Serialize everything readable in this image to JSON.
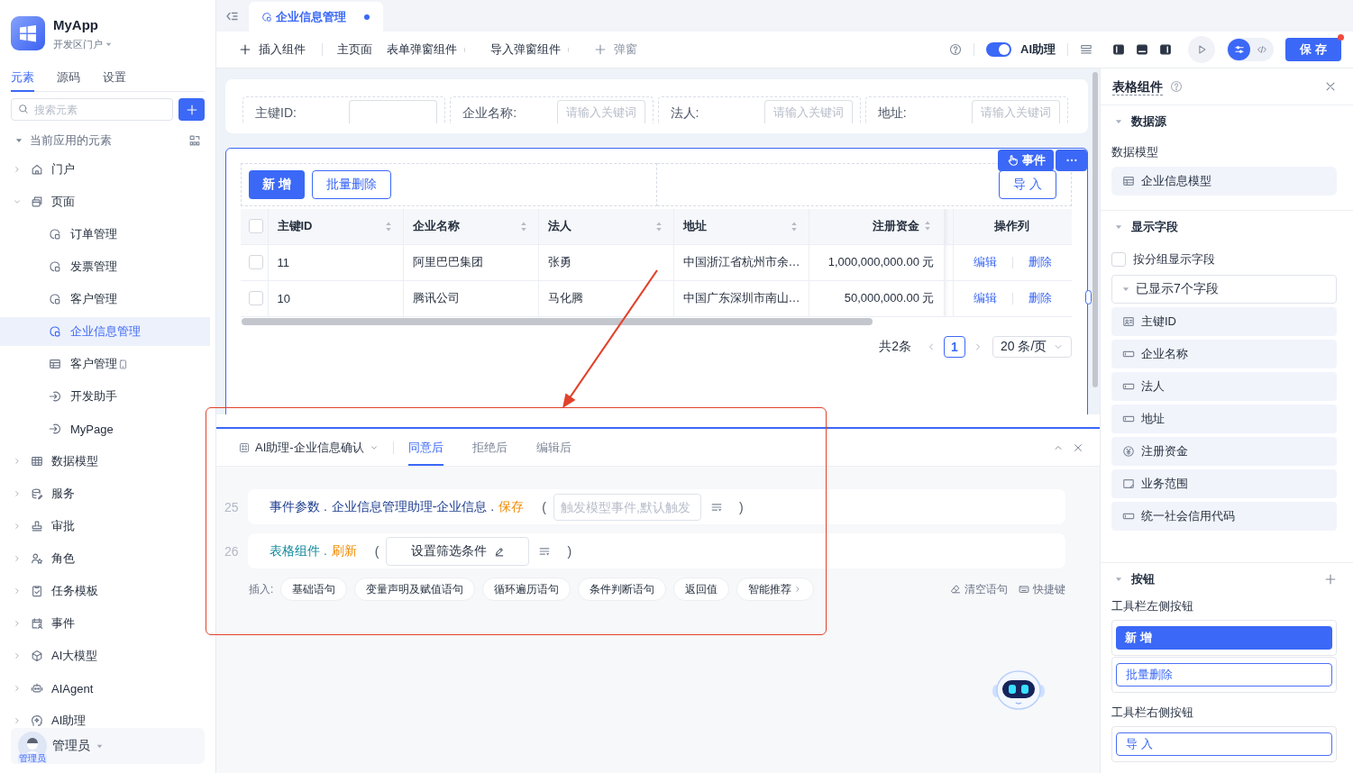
{
  "sidebar": {
    "app_name": "MyApp",
    "portal": "开发区门户",
    "tabs": [
      {
        "label": "元素",
        "selected": true
      },
      {
        "label": "源码",
        "selected": false
      },
      {
        "label": "设置",
        "selected": false
      }
    ],
    "search": {
      "placeholder": "搜索元素"
    },
    "tree": {
      "title": "当前应用的元素",
      "expanded": true,
      "items": [
        {
          "label": "门户",
          "kind": "portal",
          "expanded": false,
          "selected": false
        },
        {
          "label": "页面",
          "kind": "pages",
          "expanded": true,
          "selected": false,
          "children": [
            {
              "label": "订单管理",
              "kind": "page",
              "selected": false
            },
            {
              "label": "发票管理",
              "kind": "page",
              "selected": false
            },
            {
              "label": "客户管理",
              "kind": "page",
              "selected": false
            },
            {
              "label": "企业信息管理",
              "kind": "page",
              "selected": true
            },
            {
              "label": "客户管理",
              "kind": "mobile-page",
              "selected": false
            },
            {
              "label": "开发助手",
              "kind": "link",
              "selected": false
            },
            {
              "label": "MyPage",
              "kind": "link",
              "selected": false
            }
          ]
        },
        {
          "label": "数据模型",
          "kind": "data-model",
          "expanded": false,
          "selected": false
        },
        {
          "label": "服务",
          "kind": "service",
          "expanded": false,
          "selected": false
        },
        {
          "label": "审批",
          "kind": "approval",
          "expanded": false,
          "selected": false
        },
        {
          "label": "角色",
          "kind": "role",
          "expanded": false,
          "selected": false
        },
        {
          "label": "任务模板",
          "kind": "task",
          "expanded": false,
          "selected": false
        },
        {
          "label": "事件",
          "kind": "event",
          "expanded": false,
          "selected": false
        },
        {
          "label": "AI大模型",
          "kind": "model",
          "expanded": false,
          "selected": false
        },
        {
          "label": "AIAgent",
          "kind": "agent",
          "expanded": false,
          "selected": false
        },
        {
          "label": "AI助理",
          "kind": "assistant",
          "expanded": false,
          "selected": false
        }
      ]
    },
    "user": {
      "name": "管理员",
      "badge": "管理员"
    }
  },
  "editor_tabs": [
    {
      "label": "企业信息管理",
      "selected": true,
      "unsaved": true
    }
  ],
  "toolbar": {
    "left": [
      {
        "label": "插入组件",
        "kind": "add"
      },
      {
        "label": "主页面",
        "kind": "plain"
      },
      {
        "label": "表单弹窗组件",
        "kind": "menu"
      },
      {
        "label": "导入弹窗组件",
        "kind": "menu"
      },
      {
        "label": "弹窗",
        "kind": "add-muted"
      }
    ],
    "ai_toggle": {
      "label": "AI助理",
      "on": true
    },
    "view_modes": [
      {
        "kind": "design",
        "selected": true
      },
      {
        "kind": "code",
        "selected": false
      }
    ],
    "save": {
      "label": "保 存",
      "badge_dot": true
    }
  },
  "filter_form": {
    "fields": [
      {
        "label": "主键ID:"
      },
      {
        "label": "企业名称:",
        "placeholder": "请输入关键词"
      },
      {
        "label": "法人:",
        "placeholder": "请输入关键词"
      },
      {
        "label": "地址:",
        "placeholder": "请输入关键词"
      }
    ]
  },
  "table_card": {
    "event_button": "事件",
    "toolbar_left": [
      {
        "label": "新 增",
        "kind": "primary"
      },
      {
        "label": "批量删除",
        "kind": "outline"
      }
    ],
    "toolbar_right": [
      {
        "label": "导 入",
        "kind": "outline"
      }
    ],
    "table": {
      "all_selected": false,
      "columns": [
        {
          "label": "主键ID",
          "kind": "text",
          "sortable": true
        },
        {
          "label": "企业名称",
          "kind": "text",
          "sortable": true
        },
        {
          "label": "法人",
          "kind": "text",
          "sortable": true
        },
        {
          "label": "地址",
          "kind": "text",
          "sortable": true
        },
        {
          "label": "注册资金",
          "kind": "amount",
          "sortable": true
        },
        {
          "label": "操作列",
          "kind": "actions",
          "sortable": false
        }
      ],
      "rows": [
        {
          "selected": false,
          "cells": [
            "11",
            "阿里巴巴集团",
            "张勇",
            "中国浙江省杭州市余…",
            "1,000,000,000.00 元"
          ],
          "actions": [
            "编辑",
            "删除"
          ]
        },
        {
          "selected": false,
          "cells": [
            "10",
            "腾讯公司",
            "马化腾",
            "中国广东深圳市南山…",
            "50,000,000.00 元"
          ],
          "actions": [
            "编辑",
            "删除"
          ]
        }
      ]
    },
    "pagination": {
      "total": "共2条",
      "pages": [
        {
          "label": "1",
          "selected": true
        }
      ],
      "page_size": "20 条/页"
    }
  },
  "logic_panel": {
    "title": "AI助理-企业信息确认",
    "tabs": [
      {
        "label": "同意后",
        "selected": true
      },
      {
        "label": "拒绝后",
        "selected": false
      },
      {
        "label": "编辑后",
        "selected": false
      }
    ],
    "lines": [
      {
        "number": "25",
        "tokens": [
          {
            "text": "事件参数 .",
            "kind": "object"
          },
          {
            "text": "企业信息管理助理-企业信息 .",
            "kind": "object"
          },
          {
            "text": "保存",
            "kind": "method"
          }
        ],
        "open": "(",
        "arg": {
          "kind": "input",
          "placeholder": "触发模型事件,默认触发"
        },
        "close": ")"
      },
      {
        "number": "26",
        "tokens": [
          {
            "text": "表格组件 .",
            "kind": "component"
          },
          {
            "text": "刷新",
            "kind": "method"
          }
        ],
        "open": "(",
        "arg": {
          "kind": "button",
          "label": "设置筛选条件"
        },
        "close": ")"
      }
    ],
    "insert": {
      "label": "插入:",
      "chips": [
        {
          "label": "基础语句",
          "more": false
        },
        {
          "label": "变量声明及赋值语句",
          "more": false
        },
        {
          "label": "循环遍历语句",
          "more": false
        },
        {
          "label": "条件判断语句",
          "more": false
        },
        {
          "label": "返回值",
          "more": false
        },
        {
          "label": "智能推荐",
          "more": true
        }
      ]
    },
    "actions": [
      {
        "label": "清空语句",
        "kind": "clear"
      },
      {
        "label": "快捷键",
        "kind": "shortcuts"
      }
    ]
  },
  "properties": {
    "title": "表格组件",
    "data_source": {
      "title": "数据源",
      "expanded": true,
      "model_label": "数据模型",
      "model": "企业信息模型"
    },
    "display_fields": {
      "title": "显示字段",
      "expanded": true,
      "group_by": {
        "label": "按分组显示字段",
        "checked": false
      },
      "summary": {
        "label": "已显示7个字段",
        "expanded": true
      },
      "fields": [
        {
          "label": "主键ID",
          "kind": "id"
        },
        {
          "label": "企业名称",
          "kind": "text"
        },
        {
          "label": "法人",
          "kind": "text"
        },
        {
          "label": "地址",
          "kind": "text"
        },
        {
          "label": "注册资金",
          "kind": "money"
        },
        {
          "label": "业务范围",
          "kind": "textarea"
        },
        {
          "label": "统一社会信用代码",
          "kind": "text"
        }
      ]
    },
    "buttons": {
      "title": "按钮",
      "expanded": true,
      "groups": [
        {
          "label": "工具栏左侧按钮",
          "items": [
            {
              "label": "新 增",
              "kind": "primary"
            },
            {
              "label": "批量删除",
              "kind": "outline"
            }
          ]
        },
        {
          "label": "工具栏右侧按钮",
          "items": [
            {
              "label": "导 入",
              "kind": "outline"
            }
          ]
        }
      ]
    }
  }
}
